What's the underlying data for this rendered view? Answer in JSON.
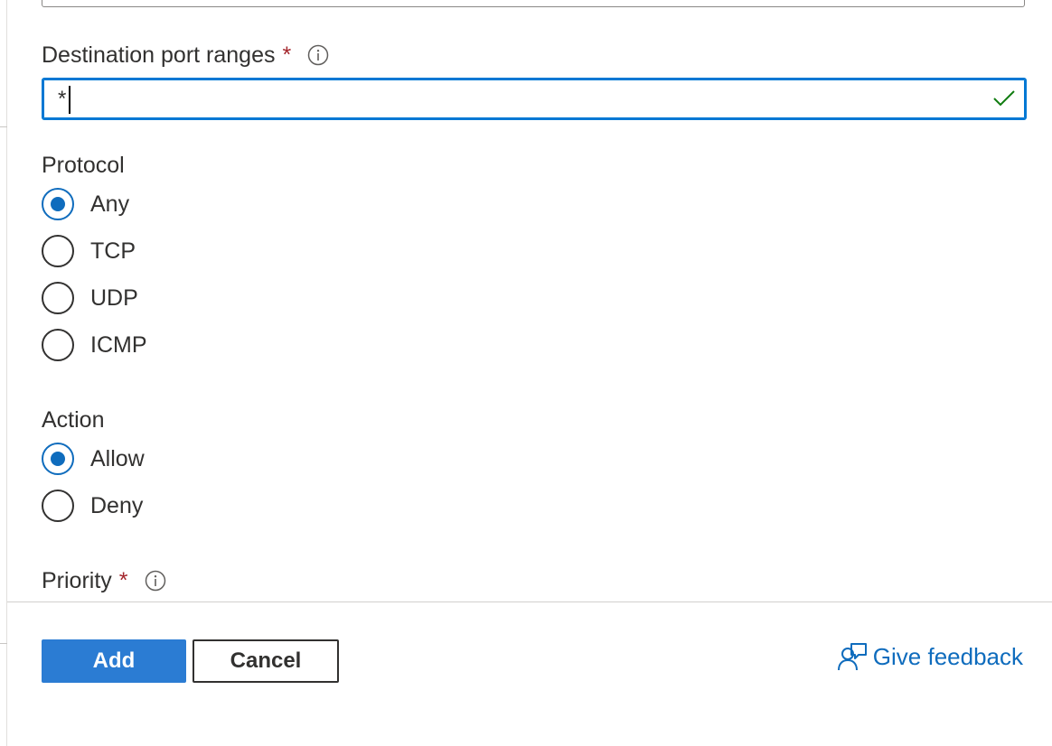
{
  "destination_port_ranges": {
    "label": "Destination port ranges",
    "required_mark": "*",
    "value": "*",
    "validation": "valid"
  },
  "protocol": {
    "label": "Protocol",
    "options": [
      {
        "label": "Any",
        "selected": true
      },
      {
        "label": "TCP",
        "selected": false
      },
      {
        "label": "UDP",
        "selected": false
      },
      {
        "label": "ICMP",
        "selected": false
      }
    ]
  },
  "action": {
    "label": "Action",
    "options": [
      {
        "label": "Allow",
        "selected": true
      },
      {
        "label": "Deny",
        "selected": false
      }
    ]
  },
  "priority": {
    "label": "Priority",
    "required_mark": "*"
  },
  "footer": {
    "add_label": "Add",
    "cancel_label": "Cancel",
    "feedback_label": "Give feedback"
  },
  "colors": {
    "accent": "#0f6cbd",
    "required": "#a4262c",
    "valid": "#107c10"
  }
}
